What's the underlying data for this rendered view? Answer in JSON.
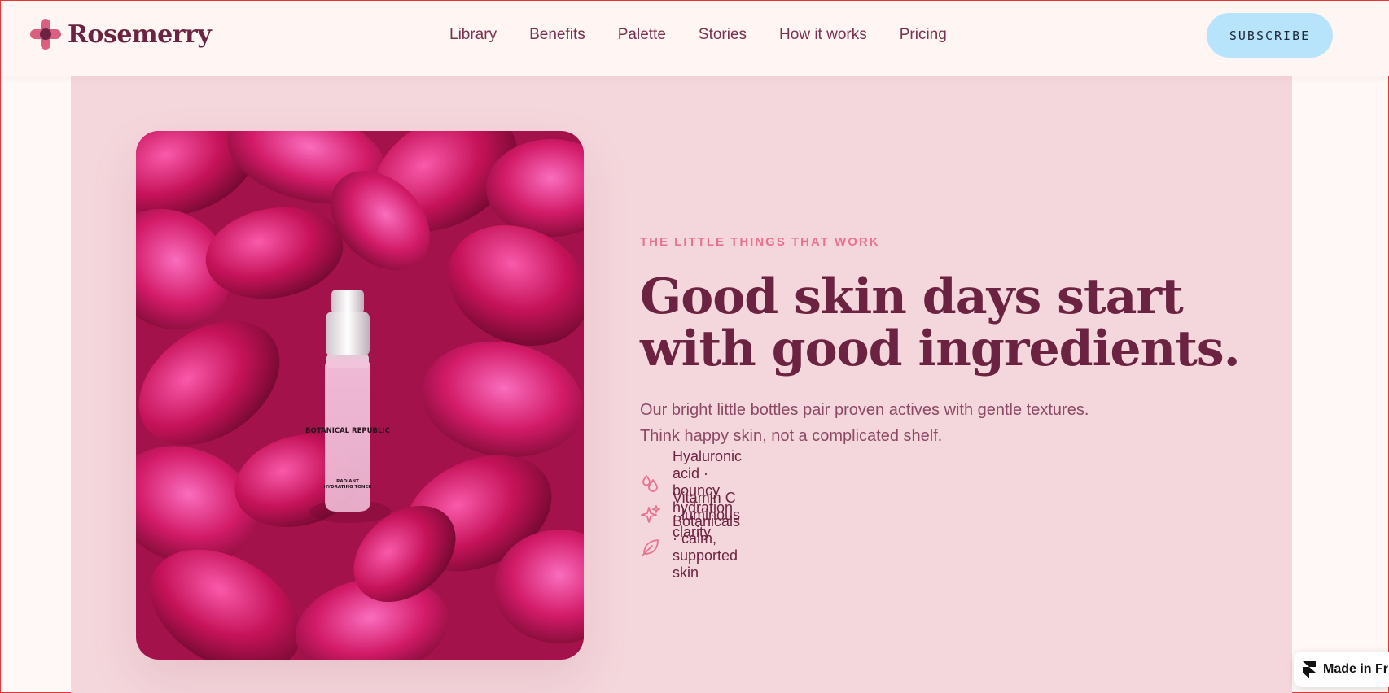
{
  "header": {
    "brand": "Rosemerry",
    "nav": [
      "Library",
      "Benefits",
      "Palette",
      "Stories",
      "How it works",
      "Pricing"
    ],
    "subscribe_label": "SUBSCRIBE"
  },
  "hero": {
    "eyebrow": "THE LITTLE THINGS THAT WORK",
    "headline": "Good skin days start with good ingredients.",
    "subtext": "Our bright little bottles pair proven actives with gentle textures. Think happy skin, not a complicated shelf.",
    "features": [
      {
        "icon": "droplets-icon",
        "text": "Hyaluronic acid · bouncy hydration"
      },
      {
        "icon": "sparkle-icon",
        "text": "Vitamin C · luminous clarity"
      },
      {
        "icon": "leaf-icon",
        "text": "Botanicals · calm, supported skin"
      }
    ],
    "image": {
      "bottle_brand": "BOTANICAL REPUBLIC",
      "bottle_product_line1": "RADIANT",
      "bottle_product_line2": "HYDRATING TONER"
    }
  },
  "badge": {
    "label": "Made in Fr"
  },
  "colors": {
    "brand": "#6b2341",
    "accent_pink": "#e8738f",
    "panel": "#f4d7dc",
    "subscribe_bg": "#b8e4fb"
  }
}
